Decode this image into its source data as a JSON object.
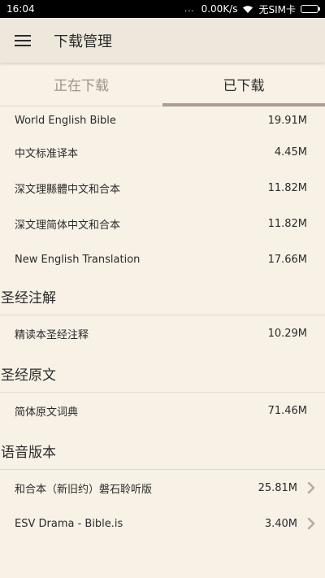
{
  "status_bar": {
    "time": "16:04",
    "dots": "...",
    "speed": "0.00K/s",
    "carrier": "无SIM卡"
  },
  "app_bar": {
    "title": "下载管理",
    "menu_icon": "hamburger-menu-icon"
  },
  "tabs": [
    {
      "label": "正在下载",
      "active": false
    },
    {
      "label": "已下载",
      "active": true
    }
  ],
  "bible_items": [
    {
      "name": "World English Bible",
      "size": "19.91M"
    },
    {
      "name": "中文标准译本",
      "size": "4.45M"
    },
    {
      "name": "深文理縣體中文和合本",
      "size": "11.82M"
    },
    {
      "name": "深文理简体中文和合本",
      "size": "11.82M"
    },
    {
      "name": "New English Translation",
      "size": "17.66M"
    }
  ],
  "sections": {
    "commentary": {
      "title": "圣经注解",
      "items": [
        {
          "name": "精读本圣经注释",
          "size": "10.29M"
        }
      ]
    },
    "original": {
      "title": "圣经原文",
      "items": [
        {
          "name": "简体原文词典",
          "size": "71.46M"
        }
      ]
    },
    "audio": {
      "title": "语音版本",
      "items": [
        {
          "name": "和合本（新旧约）磐石聆听版",
          "size": "25.81M"
        },
        {
          "name": "ESV Drama - Bible.is",
          "size": "3.40M"
        }
      ]
    }
  },
  "colors": {
    "background": "#f7f1e6",
    "app_bar": "#eee8dc",
    "tab_indicator": "#b09a94",
    "divider": "#e0d9cc"
  }
}
